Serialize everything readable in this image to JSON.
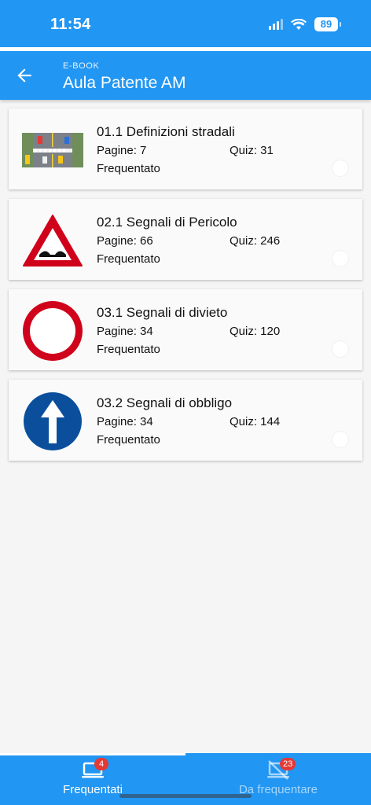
{
  "status_bar": {
    "time": "11:54",
    "battery": "89"
  },
  "app_bar": {
    "overline": "E-BOOK",
    "title": "Aula Patente AM"
  },
  "lessons": [
    {
      "title": "01.1 Definizioni stradali",
      "pages": "Pagine: 7",
      "quiz": "Quiz: 31",
      "status": "Frequentato",
      "thumb": "road-intersection"
    },
    {
      "title": "02.1 Segnali di Pericolo",
      "pages": "Pagine: 66",
      "quiz": "Quiz: 246",
      "status": "Frequentato",
      "thumb": "bumpy-road-sign"
    },
    {
      "title": "03.1 Segnali di divieto",
      "pages": "Pagine: 34",
      "quiz": "Quiz: 120",
      "status": "Frequentato",
      "thumb": "no-vehicles-sign"
    },
    {
      "title": "03.2 Segnali di obbligo",
      "pages": "Pagine: 34",
      "quiz": "Quiz: 144",
      "status": "Frequentato",
      "thumb": "straight-ahead-sign"
    }
  ],
  "bottom_nav": {
    "attended": {
      "label": "Frequentati",
      "badge": "4"
    },
    "to_attend": {
      "label": "Da frequentare",
      "badge": "23"
    }
  },
  "colors": {
    "primary": "#2196f3",
    "badge": "#e53935",
    "sign_red": "#d0021b",
    "sign_blue": "#0b4f9c"
  }
}
